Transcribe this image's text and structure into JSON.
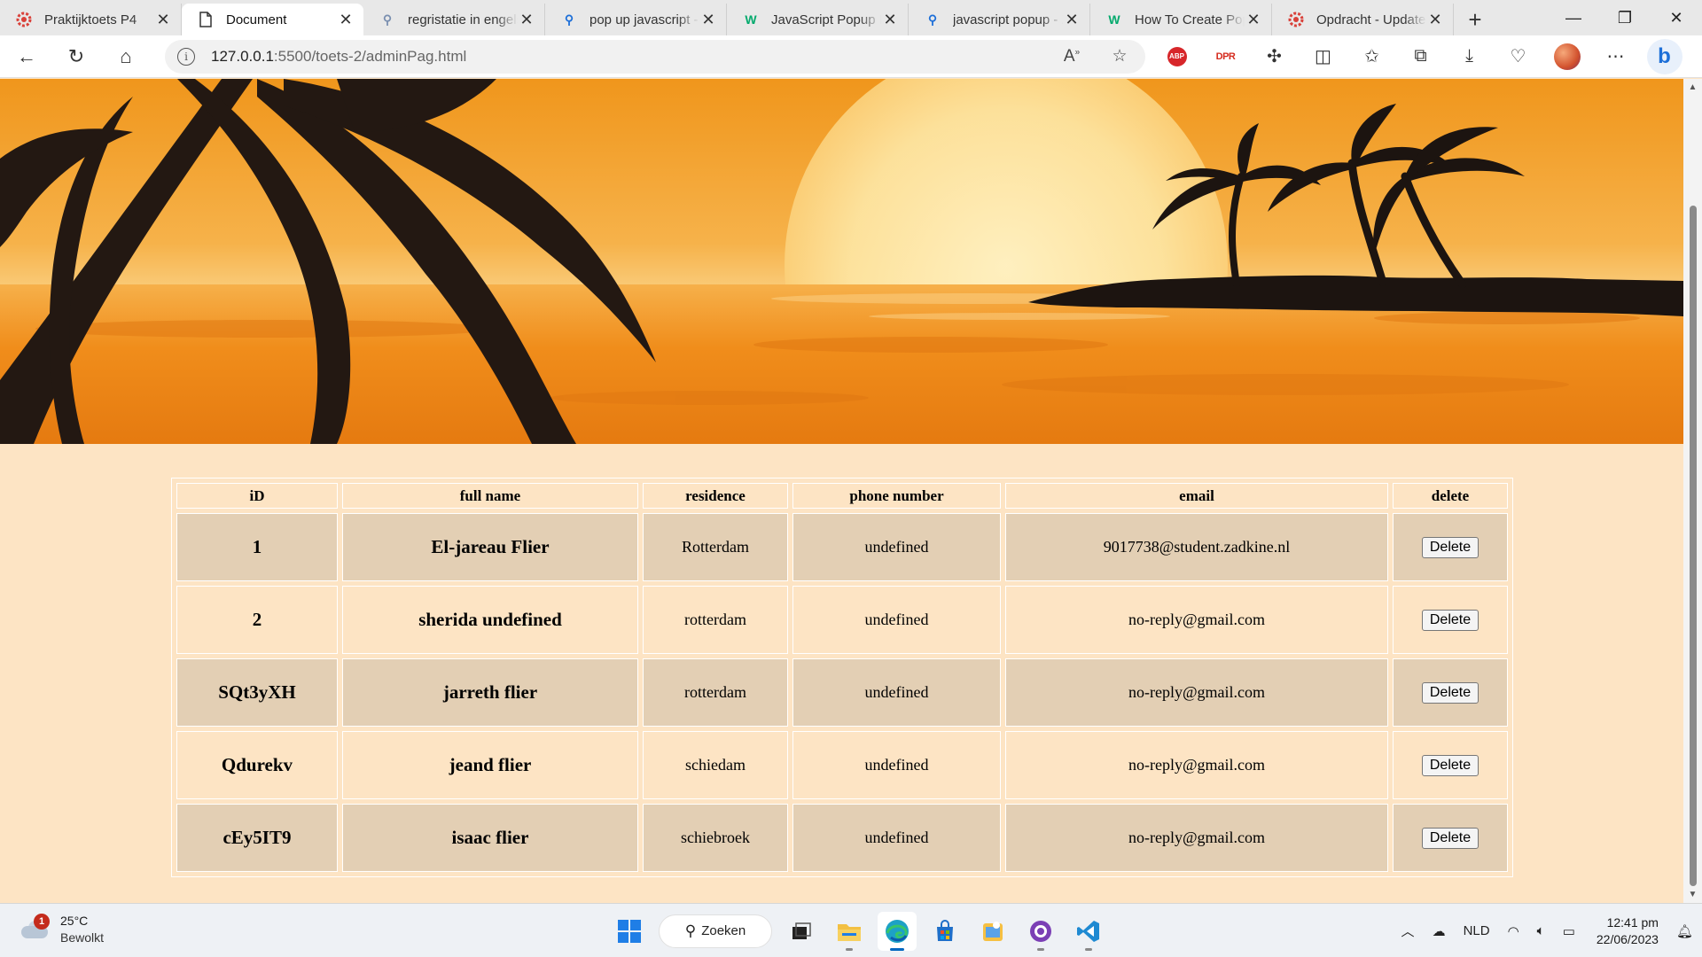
{
  "browser": {
    "tabs": [
      {
        "label": "Praktijktoets P4",
        "icon": "gear-red-icon",
        "active": false
      },
      {
        "label": "Document",
        "icon": "document-icon",
        "active": true
      },
      {
        "label": "regristatie in engels",
        "icon": "search-icon",
        "active": false
      },
      {
        "label": "pop up javascript - Zoeken",
        "icon": "search-icon",
        "active": false
      },
      {
        "label": "JavaScript Popup Boxes",
        "icon": "w3schools-icon",
        "active": false
      },
      {
        "label": "javascript popup - Zoeken",
        "icon": "search-icon",
        "active": false
      },
      {
        "label": "How To Create Popups",
        "icon": "w3schools-icon",
        "active": false
      },
      {
        "label": "Opdracht - Update",
        "icon": "gear-red-icon",
        "active": false
      }
    ],
    "address": {
      "host": "127.0.0.1",
      "path": ":5500/toets-2/adminPag.html"
    }
  },
  "table": {
    "headers": {
      "id": "iD",
      "name": "full name",
      "residence": "residence",
      "phone": "phone number",
      "email": "email",
      "delete": "delete"
    },
    "delete_label": "Delete",
    "rows": [
      {
        "id": "1",
        "name": "El-jareau Flier",
        "residence": "Rotterdam",
        "phone": "undefined",
        "email": "9017738@student.zadkine.nl"
      },
      {
        "id": "2",
        "name": "sherida undefined",
        "residence": "rotterdam",
        "phone": "undefined",
        "email": "no-reply@gmail.com"
      },
      {
        "id": "SQt3yXH",
        "name": "jarreth flier",
        "residence": "rotterdam",
        "phone": "undefined",
        "email": "no-reply@gmail.com"
      },
      {
        "id": "Qdurekv",
        "name": "jeand flier",
        "residence": "schiedam",
        "phone": "undefined",
        "email": "no-reply@gmail.com"
      },
      {
        "id": "cEy5IT9",
        "name": "isaac flier",
        "residence": "schiebroek",
        "phone": "undefined",
        "email": "no-reply@gmail.com"
      }
    ]
  },
  "taskbar": {
    "weather": {
      "temp": "25°C",
      "condition": "Bewolkt",
      "badge": "1"
    },
    "search_label": "Zoeken",
    "language": "NLD",
    "time": "12:41 pm",
    "date": "22/06/2023"
  },
  "colors": {
    "page_bg": "#fde4c4",
    "row_alt": "#e3cfb4",
    "sunset_orange": "#f29a1e",
    "accent": "#0067c0"
  }
}
